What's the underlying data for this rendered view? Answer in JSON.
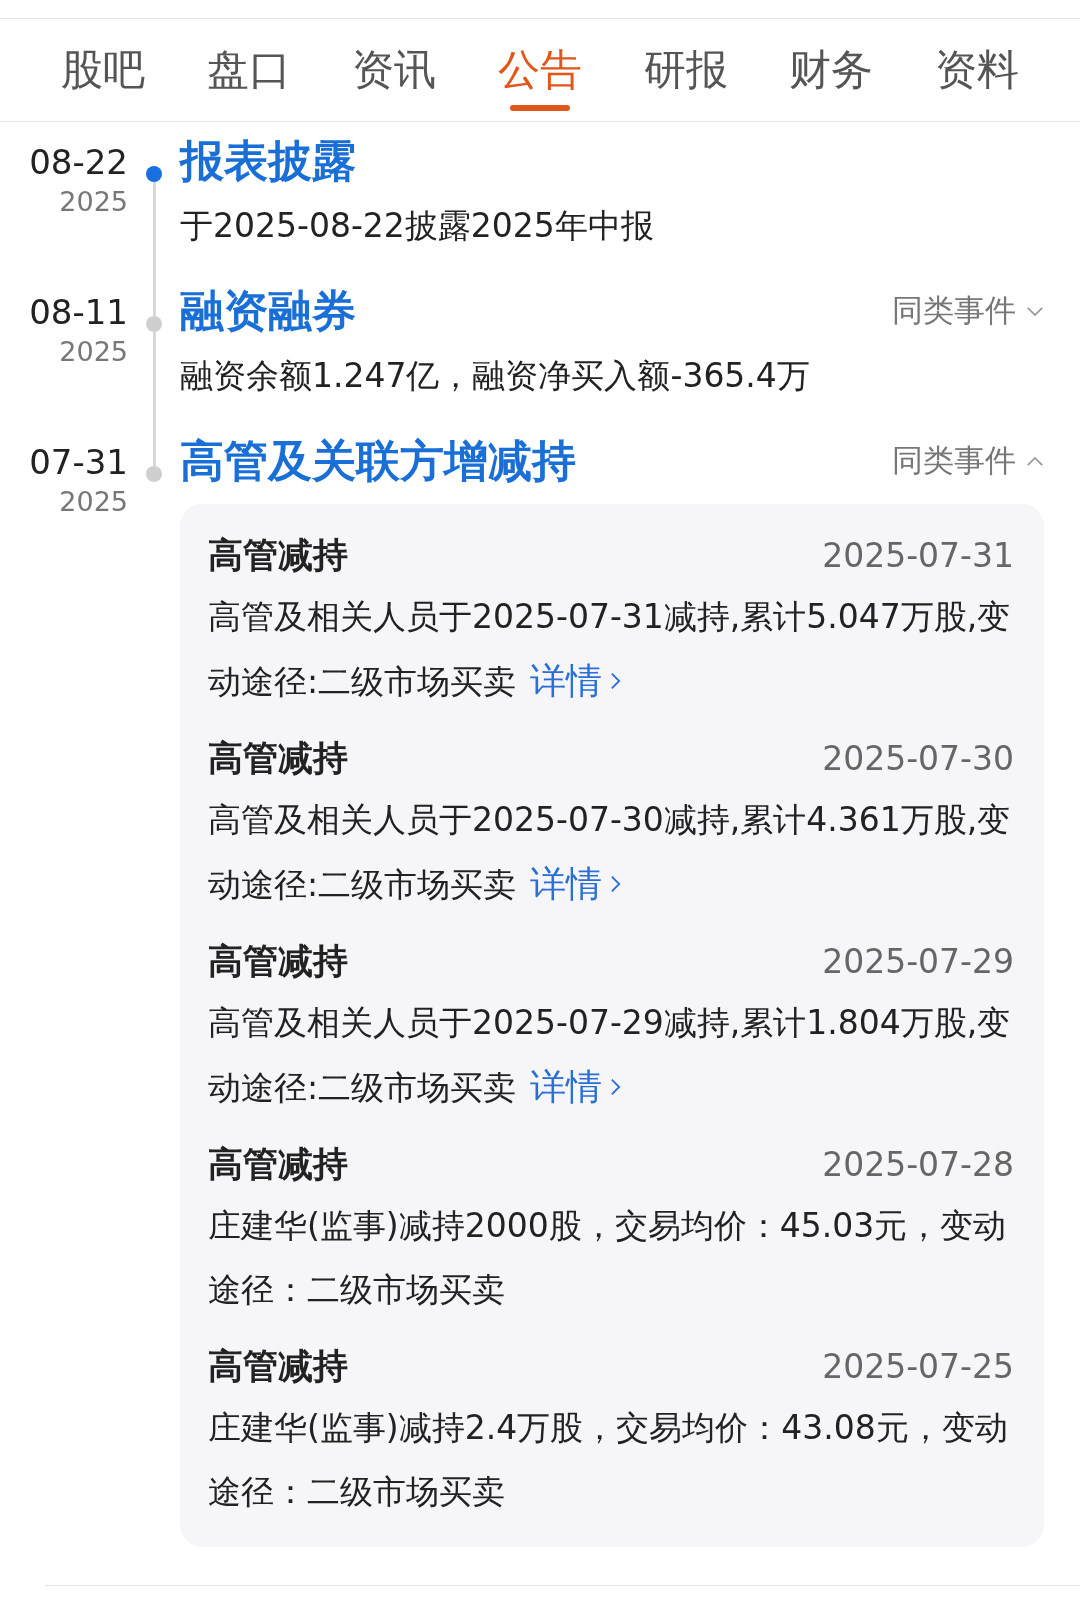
{
  "tabs": [
    {
      "label": "股吧",
      "selected": false
    },
    {
      "label": "盘口",
      "selected": false
    },
    {
      "label": "资讯",
      "selected": false
    },
    {
      "label": "公告",
      "selected": true
    },
    {
      "label": "研报",
      "selected": false
    },
    {
      "label": "财务",
      "selected": false
    },
    {
      "label": "资料",
      "selected": false
    }
  ],
  "events": [
    {
      "date": "08-22",
      "year": "2025",
      "highlighted": true,
      "title": "报表披露",
      "summary": "于2025-08-22披露2025年中报"
    },
    {
      "date": "08-11",
      "year": "2025",
      "highlighted": false,
      "title": "融资融券",
      "similar_label": "同类事件",
      "expanded": false,
      "summary": "融资余额1.247亿，融资净买入额-365.4万"
    },
    {
      "date": "07-31",
      "year": "2025",
      "highlighted": false,
      "title": "高管及关联方增减持",
      "similar_label": "同类事件",
      "expanded": true,
      "items": [
        {
          "title": "高管减持",
          "date": "2025-07-31",
          "text": "高管及相关人员于2025-07-31减持,累计5.047万股,变动途径:二级市场买卖",
          "link": "详情"
        },
        {
          "title": "高管减持",
          "date": "2025-07-30",
          "text": "高管及相关人员于2025-07-30减持,累计4.361万股,变动途径:二级市场买卖",
          "link": "详情"
        },
        {
          "title": "高管减持",
          "date": "2025-07-29",
          "text": "高管及相关人员于2025-07-29减持,累计1.804万股,变动途径:二级市场买卖",
          "link": "详情"
        },
        {
          "title": "高管减持",
          "date": "2025-07-28",
          "text": "庄建华(监事)减持2000股，交易均价：45.03元，变动途径：二级市场买卖"
        },
        {
          "title": "高管减持",
          "date": "2025-07-25",
          "text": "庄建华(监事)减持2.4万股，交易均价：43.08元，变动途径：二级市场买卖"
        }
      ]
    }
  ]
}
